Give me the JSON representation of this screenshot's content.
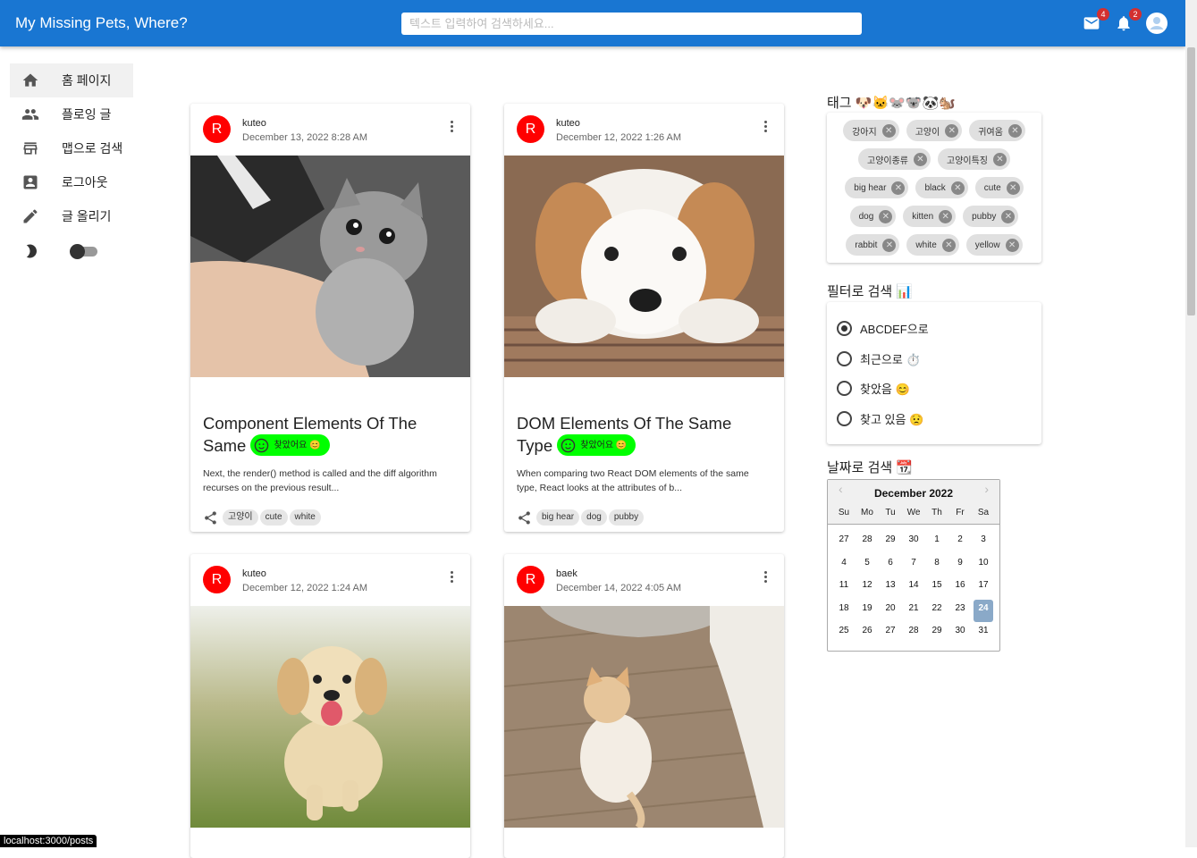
{
  "header": {
    "title": "My Missing Pets, Where?",
    "search_placeholder": "텍스트 입력하여 검색하세요...",
    "mail_count": "4",
    "notification_count": "2",
    "colors": {
      "appbar": "#1976d2"
    }
  },
  "sidebar": {
    "items": [
      {
        "label": "홈 페이지",
        "icon": "home-icon"
      },
      {
        "label": "플로잉 글",
        "icon": "people-icon"
      },
      {
        "label": "맵으로 검색",
        "icon": "store-icon"
      },
      {
        "label": "로그아웃",
        "icon": "account-box-icon"
      },
      {
        "label": "글 올리기",
        "icon": "pencil-icon"
      }
    ],
    "dark_mode_icon": "moon-icon"
  },
  "posts": [
    {
      "avatar": "R",
      "author": "kuteo",
      "date": "December 13, 2022 8:28 AM",
      "image": "gray-kitten-photo",
      "title": "Component Elements Of The Same",
      "status": "찾았어요 😊",
      "desc": "Next, the render() method is called and the diff algorithm recurses on the previous result...",
      "tags": [
        "고양이",
        "cute",
        "white"
      ]
    },
    {
      "avatar": "R",
      "author": "kuteo",
      "date": "December 12, 2022 1:26 AM",
      "image": "puppy-lying-photo",
      "title": "DOM Elements Of The Same Type",
      "status": "찾았어요 😊",
      "desc": "When comparing two React DOM elements of the same type, React looks at the attributes of b...",
      "tags": [
        "big hear",
        "dog",
        "pubby"
      ]
    },
    {
      "avatar": "R",
      "author": "kuteo",
      "date": "December 12, 2022 1:24 AM",
      "image": "golden-puppy-running-photo"
    },
    {
      "avatar": "R",
      "author": "baek",
      "date": "December 14, 2022 4:05 AM",
      "image": "orange-kitten-floor-photo"
    }
  ],
  "tags_panel": {
    "title": "태그 🐶🐱🐭🐨🐼🐿️",
    "rows": [
      [
        "강아지",
        "고양이",
        "귀여움"
      ],
      [
        "고양이종류",
        "고양이특징"
      ],
      [
        "big hear",
        "black",
        "cute"
      ],
      [
        "dog",
        "kitten",
        "pubby"
      ],
      [
        "rabbit",
        "white",
        "yellow"
      ]
    ]
  },
  "filter_panel": {
    "title": "필터로 검색 📊",
    "options": [
      "ABCDEF으로",
      "최근으로 ⏱️",
      "찾았음 😊",
      "찾고 있음 😟"
    ],
    "selected": "ABCDEF으로"
  },
  "date_panel": {
    "title": "날짜로 검색 📆",
    "month": "December 2022",
    "dows": [
      "Su",
      "Mo",
      "Tu",
      "We",
      "Th",
      "Fr",
      "Sa"
    ],
    "weeks": [
      [
        "27",
        "28",
        "29",
        "30",
        "1",
        "2",
        "3"
      ],
      [
        "4",
        "5",
        "6",
        "7",
        "8",
        "9",
        "10"
      ],
      [
        "11",
        "12",
        "13",
        "14",
        "15",
        "16",
        "17"
      ],
      [
        "18",
        "19",
        "20",
        "21",
        "22",
        "23",
        "24"
      ],
      [
        "25",
        "26",
        "27",
        "28",
        "29",
        "30",
        "31"
      ]
    ],
    "selected_day": "24"
  },
  "status_bar": "localhost:3000/posts"
}
